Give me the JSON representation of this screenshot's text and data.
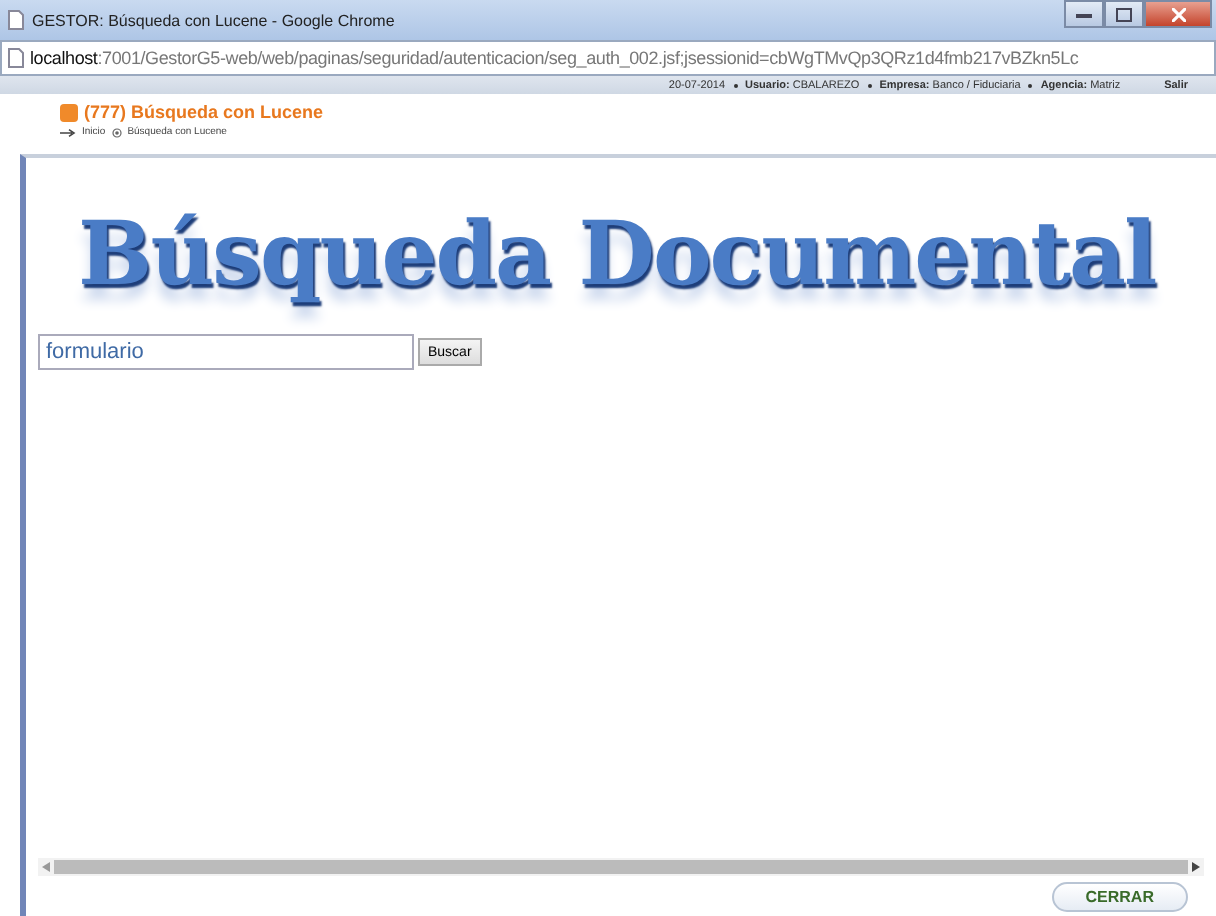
{
  "window": {
    "title": "GESTOR: Búsqueda con Lucene - Google Chrome"
  },
  "address_bar": {
    "host": "localhost",
    "path": ":7001/GestorG5-web/web/paginas/seguridad/autenticacion/seg_auth_002.jsf;jsessionid=cbWgTMvQp3QRz1d4fmb217vBZkn5Lc"
  },
  "info_bar": {
    "date": "20-07-2014",
    "user_label": "Usuario:",
    "user": "CBALAREZO",
    "company_label": "Empresa:",
    "company": "Banco / Fiduciaria",
    "agency_label": "Agencia:",
    "agency": "Matriz",
    "logout": "Salir"
  },
  "page_title": "(777) Búsqueda con Lucene",
  "breadcrumb": [
    "Inicio",
    "Búsqueda con Lucene"
  ],
  "banner": "Búsqueda Documental",
  "search": {
    "value": "formulario",
    "button": "Buscar"
  },
  "close_button": "CERRAR"
}
